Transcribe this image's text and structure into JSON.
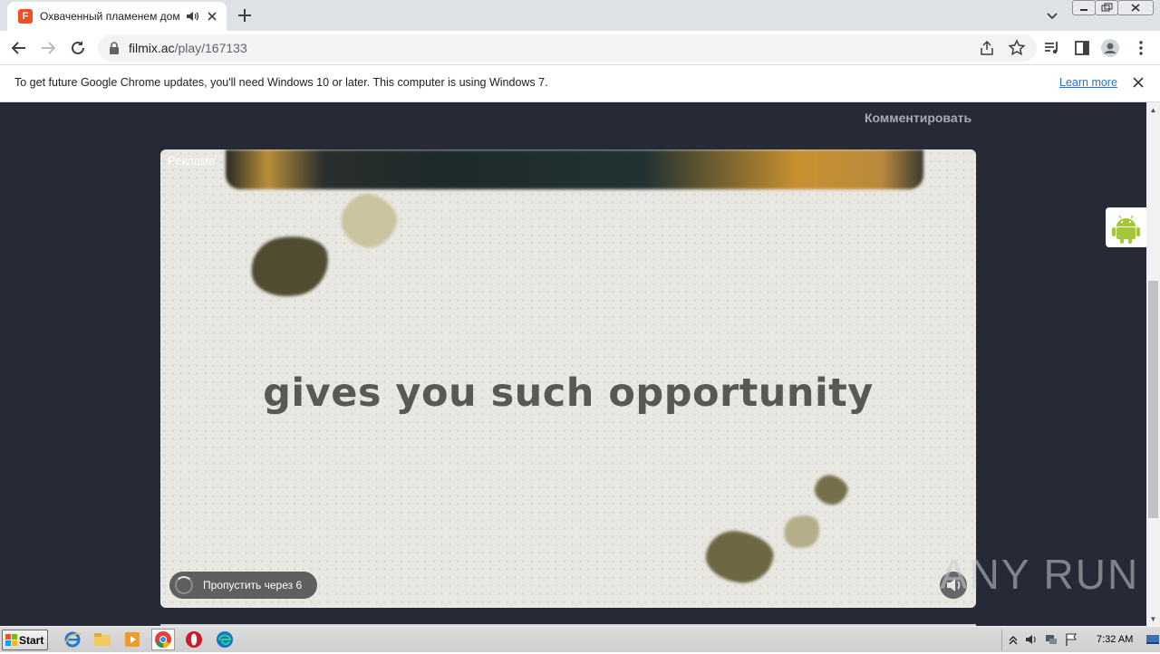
{
  "browser": {
    "tab": {
      "title": "Охваченный пламенем дом Ма",
      "favicon_letter": "F"
    },
    "address": {
      "domain": "filmix.ac",
      "path": "/play/167133"
    },
    "infobar": {
      "message": "To get future Google Chrome updates, you'll need Windows 10 or later. This computer is using Windows 7.",
      "link": "Learn more"
    }
  },
  "page": {
    "comment_link": "Комментировать",
    "ad": {
      "label": "Реклама",
      "headline": "gives you such opportunity",
      "skip_label": "Пропустить через 6"
    },
    "watermark": "ANY RUN"
  },
  "taskbar": {
    "start_label": "Start",
    "clock": "7:32 AM"
  },
  "colors": {
    "page_bg": "#262a36",
    "chrome_tab_strip": "#dee1e6",
    "link_blue": "#1a73e8",
    "favicon": "#f04e23",
    "android_green": "#a4c639"
  }
}
